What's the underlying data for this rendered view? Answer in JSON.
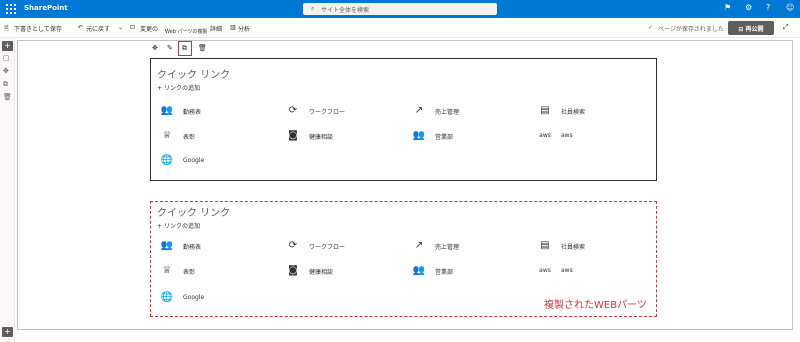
{
  "header": {
    "app_title": "SharePoint",
    "search_placeholder": "サイト全体を検索",
    "icons": [
      "waffle-icon",
      "chat-icon",
      "gear-icon",
      "help-icon",
      "person-icon"
    ]
  },
  "commandbar": {
    "save_draft": "下書きとして保存",
    "undo": "元に戻す",
    "change_prefix": "変更の",
    "tooltip_suffix": "詳細",
    "analytics": "分析",
    "saved_status": "ページが保存されました",
    "republish": "再公開"
  },
  "tooltip": "Web パーツの複製",
  "webparts": [
    {
      "title": "クイック リンク",
      "add_link": "リンクの追加",
      "links": [
        {
          "label": "勤務表",
          "icon": "people-icon"
        },
        {
          "label": "ワークフロー",
          "icon": "flow-icon"
        },
        {
          "label": "売上管理",
          "icon": "chart-icon"
        },
        {
          "label": "社員検索",
          "icon": "id-card-icon"
        },
        {
          "label": "表彰",
          "icon": "trophy-icon"
        },
        {
          "label": "健康相談",
          "icon": "camera-icon"
        },
        {
          "label": "営業部",
          "icon": "people-icon"
        },
        {
          "label": "aws",
          "icon": "aws-icon"
        },
        {
          "label": "Google",
          "icon": "globe-icon"
        }
      ]
    },
    {
      "title": "クイック リンク",
      "add_link": "リンクの追加",
      "links": [
        {
          "label": "勤務表",
          "icon": "people-icon"
        },
        {
          "label": "ワークフロー",
          "icon": "flow-icon"
        },
        {
          "label": "売上管理",
          "icon": "chart-icon"
        },
        {
          "label": "社員検索",
          "icon": "id-card-icon"
        },
        {
          "label": "表彰",
          "icon": "trophy-icon"
        },
        {
          "label": "健康相談",
          "icon": "camera-icon"
        },
        {
          "label": "営業部",
          "icon": "people-icon"
        },
        {
          "label": "aws",
          "icon": "aws-icon"
        },
        {
          "label": "Google",
          "icon": "globe-icon"
        }
      ]
    }
  ],
  "duplicate_annotation": "複製されたWEBパーツ"
}
